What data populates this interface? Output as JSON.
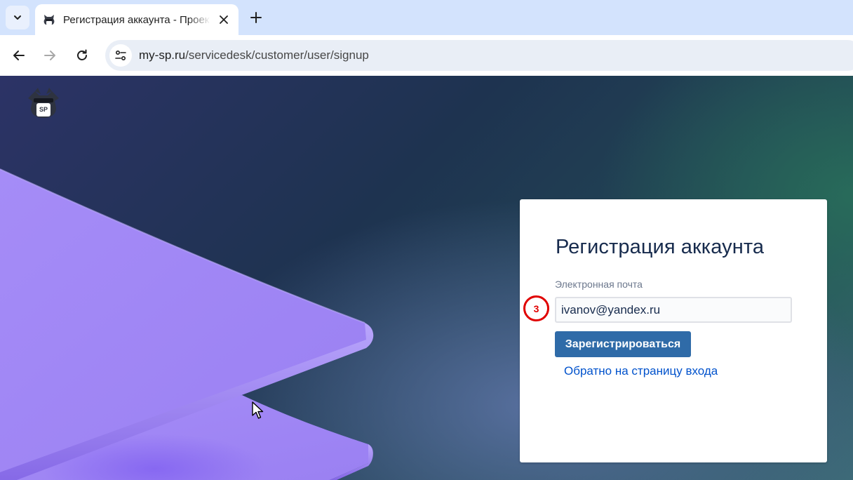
{
  "browser": {
    "tab": {
      "title": "Регистрация аккаунта - Проект",
      "favicon": "sp-cat-logo-icon"
    },
    "url": {
      "host": "my-sp.ru",
      "path": "/servicedesk/customer/user/signup"
    },
    "icons": {
      "tab_search": "chevron-down-icon",
      "close_tab": "close-icon",
      "new_tab": "plus-icon",
      "back": "arrow-left-icon",
      "forward": "arrow-right-icon",
      "reload": "reload-icon",
      "site_info": "tune-icon"
    }
  },
  "page": {
    "logo_text": "SP",
    "card": {
      "title": "Регистрация аккаунта",
      "email_label": "Электронная почта",
      "email_value": "ivanov@yandex.ru",
      "step_number": "3",
      "submit_label": "Зарегистрироваться",
      "back_link": "Обратно на страницу входа"
    }
  },
  "colors": {
    "primary_button": "#2f6ba8",
    "link": "#0052cc",
    "heading": "#172b4d",
    "step_marker": "#e00000",
    "decor_purple": "#9f85f5"
  }
}
